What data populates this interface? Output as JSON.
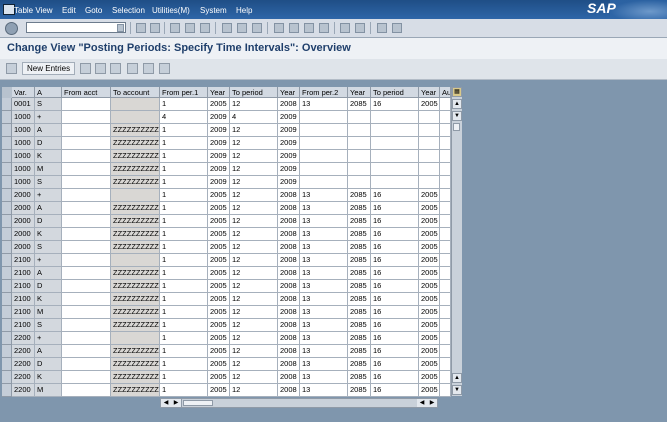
{
  "menu": {
    "items": [
      "Table View",
      "Edit",
      "Goto",
      "Selection",
      "Utilities(M)",
      "System",
      "Help"
    ],
    "logo": "SAP"
  },
  "toolbar": {
    "command_value": ""
  },
  "title": "Change View \"Posting Periods: Specify Time Intervals\": Overview",
  "app_toolbar": {
    "new_entries": "New Entries"
  },
  "table": {
    "columns": [
      "Var.",
      "A",
      "From acct",
      "To account",
      "From per.1",
      "Year",
      "To period",
      "Year",
      "From per.2",
      "Year",
      "To period",
      "Year",
      "Au"
    ],
    "rows": [
      [
        "0001",
        "S",
        "",
        "",
        "1",
        "2005",
        "12",
        "2008",
        "13",
        "2085",
        "16",
        "2005"
      ],
      [
        "1000",
        "+",
        "",
        "",
        "4",
        "2009",
        "4",
        "2009",
        "",
        "",
        "",
        ""
      ],
      [
        "1000",
        "A",
        "",
        "ZZZZZZZZZZ",
        "1",
        "2009",
        "12",
        "2009",
        "",
        "",
        "",
        ""
      ],
      [
        "1000",
        "D",
        "",
        "ZZZZZZZZZZ",
        "1",
        "2009",
        "12",
        "2009",
        "",
        "",
        "",
        ""
      ],
      [
        "1000",
        "K",
        "",
        "ZZZZZZZZZZ",
        "1",
        "2009",
        "12",
        "2009",
        "",
        "",
        "",
        ""
      ],
      [
        "1000",
        "M",
        "",
        "ZZZZZZZZZZ",
        "1",
        "2009",
        "12",
        "2009",
        "",
        "",
        "",
        ""
      ],
      [
        "1000",
        "S",
        "",
        "ZZZZZZZZZZ",
        "1",
        "2009",
        "12",
        "2009",
        "",
        "",
        "",
        ""
      ],
      [
        "2000",
        "+",
        "",
        "",
        "1",
        "2005",
        "12",
        "2008",
        "13",
        "2085",
        "16",
        "2005"
      ],
      [
        "2000",
        "A",
        "",
        "ZZZZZZZZZZ",
        "1",
        "2005",
        "12",
        "2008",
        "13",
        "2085",
        "16",
        "2005"
      ],
      [
        "2000",
        "D",
        "",
        "ZZZZZZZZZZ",
        "1",
        "2005",
        "12",
        "2008",
        "13",
        "2085",
        "16",
        "2005"
      ],
      [
        "2000",
        "K",
        "",
        "ZZZZZZZZZZ",
        "1",
        "2005",
        "12",
        "2008",
        "13",
        "2085",
        "16",
        "2005"
      ],
      [
        "2000",
        "S",
        "",
        "ZZZZZZZZZZ",
        "1",
        "2005",
        "12",
        "2008",
        "13",
        "2085",
        "16",
        "2005"
      ],
      [
        "2100",
        "+",
        "",
        "",
        "1",
        "2005",
        "12",
        "2008",
        "13",
        "2085",
        "16",
        "2005"
      ],
      [
        "2100",
        "A",
        "",
        "ZZZZZZZZZZ",
        "1",
        "2005",
        "12",
        "2008",
        "13",
        "2085",
        "16",
        "2005"
      ],
      [
        "2100",
        "D",
        "",
        "ZZZZZZZZZZ",
        "1",
        "2005",
        "12",
        "2008",
        "13",
        "2085",
        "16",
        "2005"
      ],
      [
        "2100",
        "K",
        "",
        "ZZZZZZZZZZ",
        "1",
        "2005",
        "12",
        "2008",
        "13",
        "2085",
        "16",
        "2005"
      ],
      [
        "2100",
        "M",
        "",
        "ZZZZZZZZZZ",
        "1",
        "2005",
        "12",
        "2008",
        "13",
        "2085",
        "16",
        "2005"
      ],
      [
        "2100",
        "S",
        "",
        "ZZZZZZZZZZ",
        "1",
        "2005",
        "12",
        "2008",
        "13",
        "2085",
        "16",
        "2005"
      ],
      [
        "2200",
        "+",
        "",
        "",
        "1",
        "2005",
        "12",
        "2008",
        "13",
        "2085",
        "16",
        "2005"
      ],
      [
        "2200",
        "A",
        "",
        "ZZZZZZZZZZ",
        "1",
        "2005",
        "12",
        "2008",
        "13",
        "2085",
        "16",
        "2005"
      ],
      [
        "2200",
        "D",
        "",
        "ZZZZZZZZZZ",
        "1",
        "2005",
        "12",
        "2008",
        "13",
        "2085",
        "16",
        "2005"
      ],
      [
        "2200",
        "K",
        "",
        "ZZZZZZZZZZ",
        "1",
        "2005",
        "12",
        "2008",
        "13",
        "2085",
        "16",
        "2005"
      ],
      [
        "2200",
        "M",
        "",
        "ZZZZZZZZZZ",
        "1",
        "2005",
        "12",
        "2008",
        "13",
        "2085",
        "16",
        "2005"
      ]
    ]
  }
}
